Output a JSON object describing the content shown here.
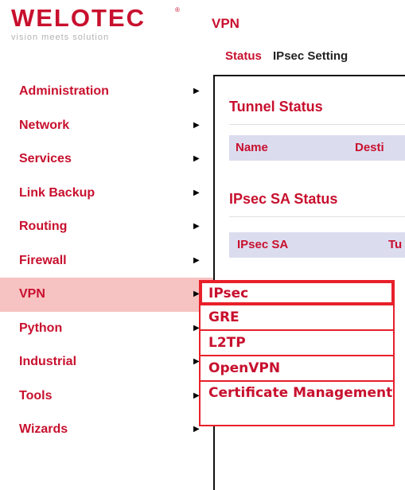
{
  "brand": {
    "name": "WELOTEC",
    "tagline": "vision meets solution"
  },
  "page": {
    "title": "VPN"
  },
  "tabs": [
    {
      "label": "Status"
    },
    {
      "label": "IPsec Setting"
    }
  ],
  "nav": {
    "items": [
      {
        "label": "Administration"
      },
      {
        "label": "Network"
      },
      {
        "label": "Services"
      },
      {
        "label": "Link Backup"
      },
      {
        "label": "Routing"
      },
      {
        "label": "Firewall"
      },
      {
        "label": "VPN"
      },
      {
        "label": "Python"
      },
      {
        "label": "Industrial"
      },
      {
        "label": "Tools"
      },
      {
        "label": "Wizards"
      }
    ]
  },
  "tunnel_status": {
    "title": "Tunnel Status",
    "columns": [
      "Name",
      "Desti"
    ]
  },
  "ipsec_sa_status": {
    "title": "IPsec SA Status",
    "columns": [
      "IPsec SA",
      "Tu"
    ]
  },
  "vpn_submenu": {
    "items": [
      {
        "label": "IPsec"
      },
      {
        "label": "GRE"
      },
      {
        "label": "L2TP"
      },
      {
        "label": "OpenVPN"
      },
      {
        "label": "Certificate Management"
      }
    ]
  },
  "colors": {
    "brand_red": "#c8102e",
    "active_bg": "#f7c2c2",
    "table_header_bg": "#dcdcef"
  }
}
